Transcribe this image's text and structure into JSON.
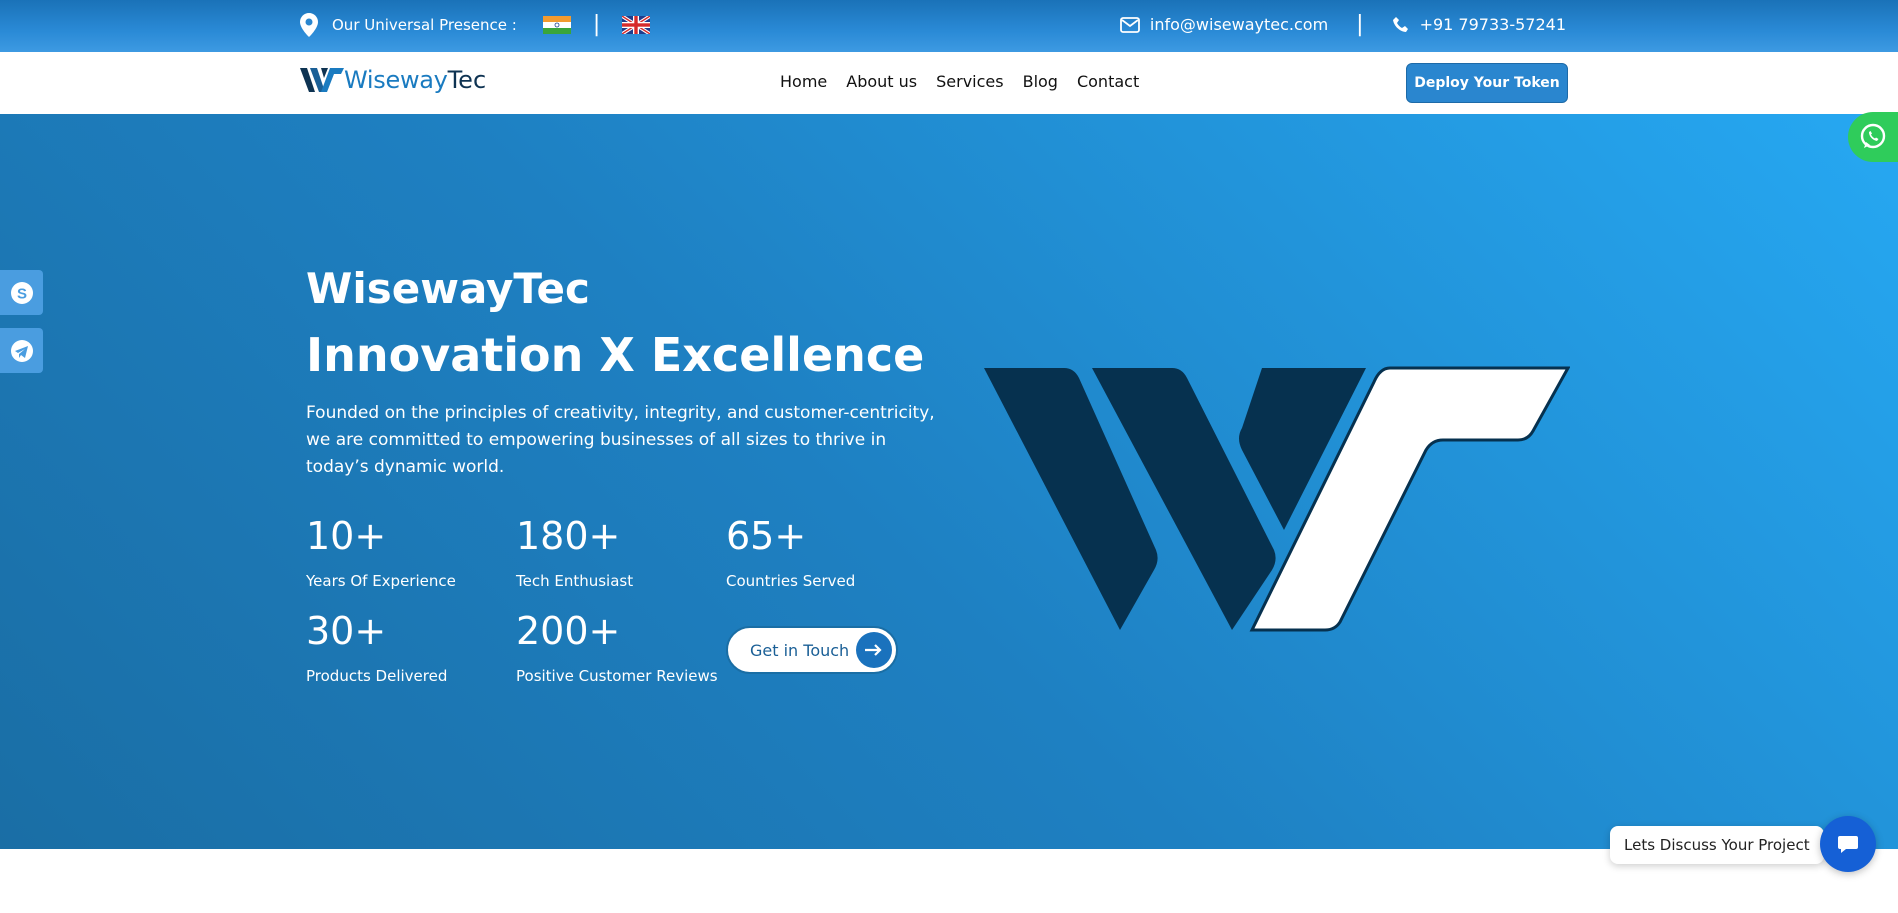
{
  "topbar": {
    "presence_label": "Our Universal Presence :",
    "flags": [
      "india-flag",
      "uk-flag"
    ],
    "flag_separator": "|",
    "email": "info@wisewaytec.com",
    "contact_separator": "|",
    "phone": "+91 79733-57241"
  },
  "navbar": {
    "logo_part1": "Wiseway",
    "logo_part2": "Tec",
    "links": [
      "Home",
      "About us",
      "Services",
      "Blog",
      "Contact"
    ],
    "cta": "Deploy Your Token"
  },
  "hero": {
    "brand": "WisewayTec",
    "tagline": "Innovation X Excellence",
    "description": "Founded on the principles of creativity, integrity, and customer-centricity, we are committed to empowering businesses of all sizes to thrive in today’s dynamic world.",
    "stats": [
      {
        "num": "10+",
        "label": "Years Of Experience"
      },
      {
        "num": "180+",
        "label": "Tech Enthusiast"
      },
      {
        "num": "65+",
        "label": "Countries Served"
      },
      {
        "num": "30+",
        "label": "Products Delivered"
      },
      {
        "num": "200+",
        "label": "Positive Customer Reviews"
      }
    ],
    "cta": "Get in Touch"
  },
  "chat": {
    "label": "Lets Discuss Your Project"
  },
  "colors": {
    "primary": "#1a7bc0",
    "dark": "#0e3352",
    "whatsapp": "#2fcc5b",
    "chat": "#1560d6"
  }
}
